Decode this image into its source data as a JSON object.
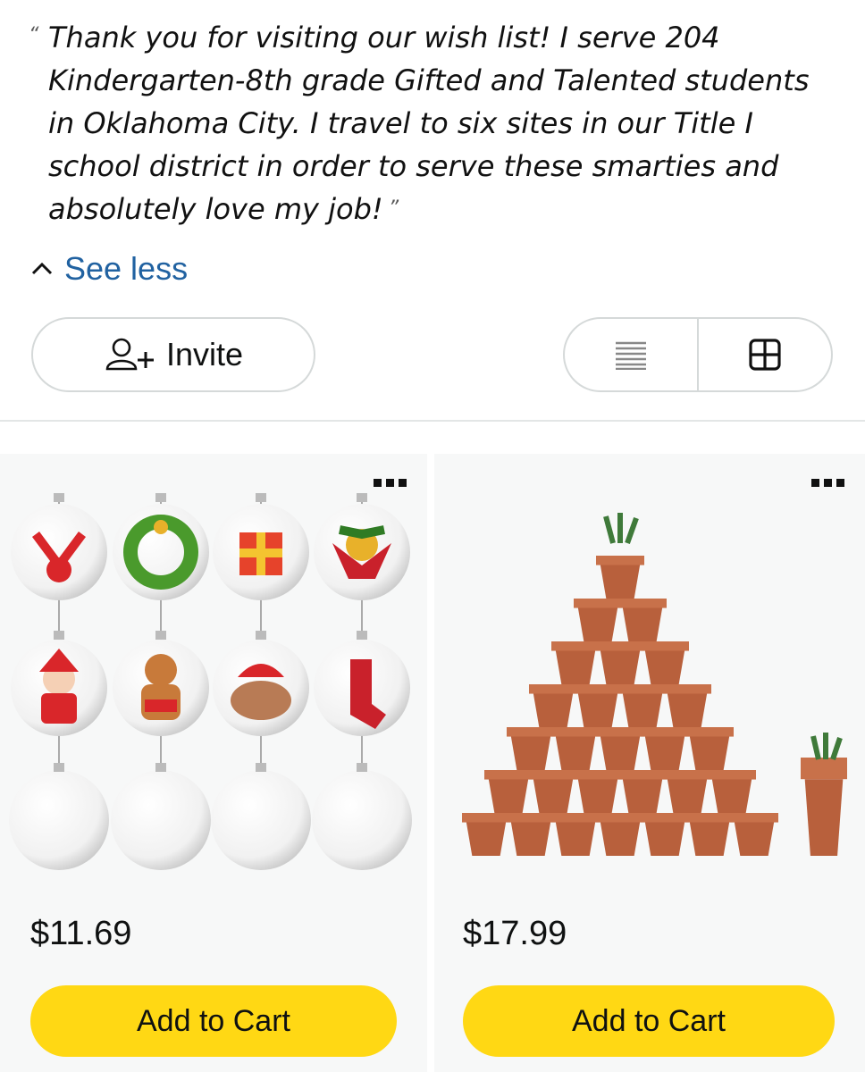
{
  "description": {
    "open_quote": "“",
    "text": "Thank you for visiting our wish list! I serve 204 Kindergarten-8th grade Gifted and Talented students in Oklahoma City. I travel to six sites in our Title I school district in order to serve these smarties and absolutely love my job!",
    "close_quote": "”"
  },
  "see_less": {
    "label": "See less",
    "icon": "chevron-up-icon"
  },
  "toolbar": {
    "invite_label": "Invite",
    "invite_icon": "add-person-icon",
    "list_view_icon": "list-view-icon",
    "grid_view_icon": "grid-view-icon"
  },
  "items": [
    {
      "price": "$11.69",
      "cart_label": "Add to Cart",
      "image": "christmas-ornaments-image",
      "menu_icon": "more-options-icon"
    },
    {
      "price": "$17.99",
      "cart_label": "Add to Cart",
      "image": "terracotta-pots-image",
      "menu_icon": "more-options-icon"
    }
  ],
  "colors": {
    "link": "#2162a1",
    "cart_button": "#ffd814",
    "border": "#d5d9d9",
    "card_bg": "#f7f8f8"
  }
}
